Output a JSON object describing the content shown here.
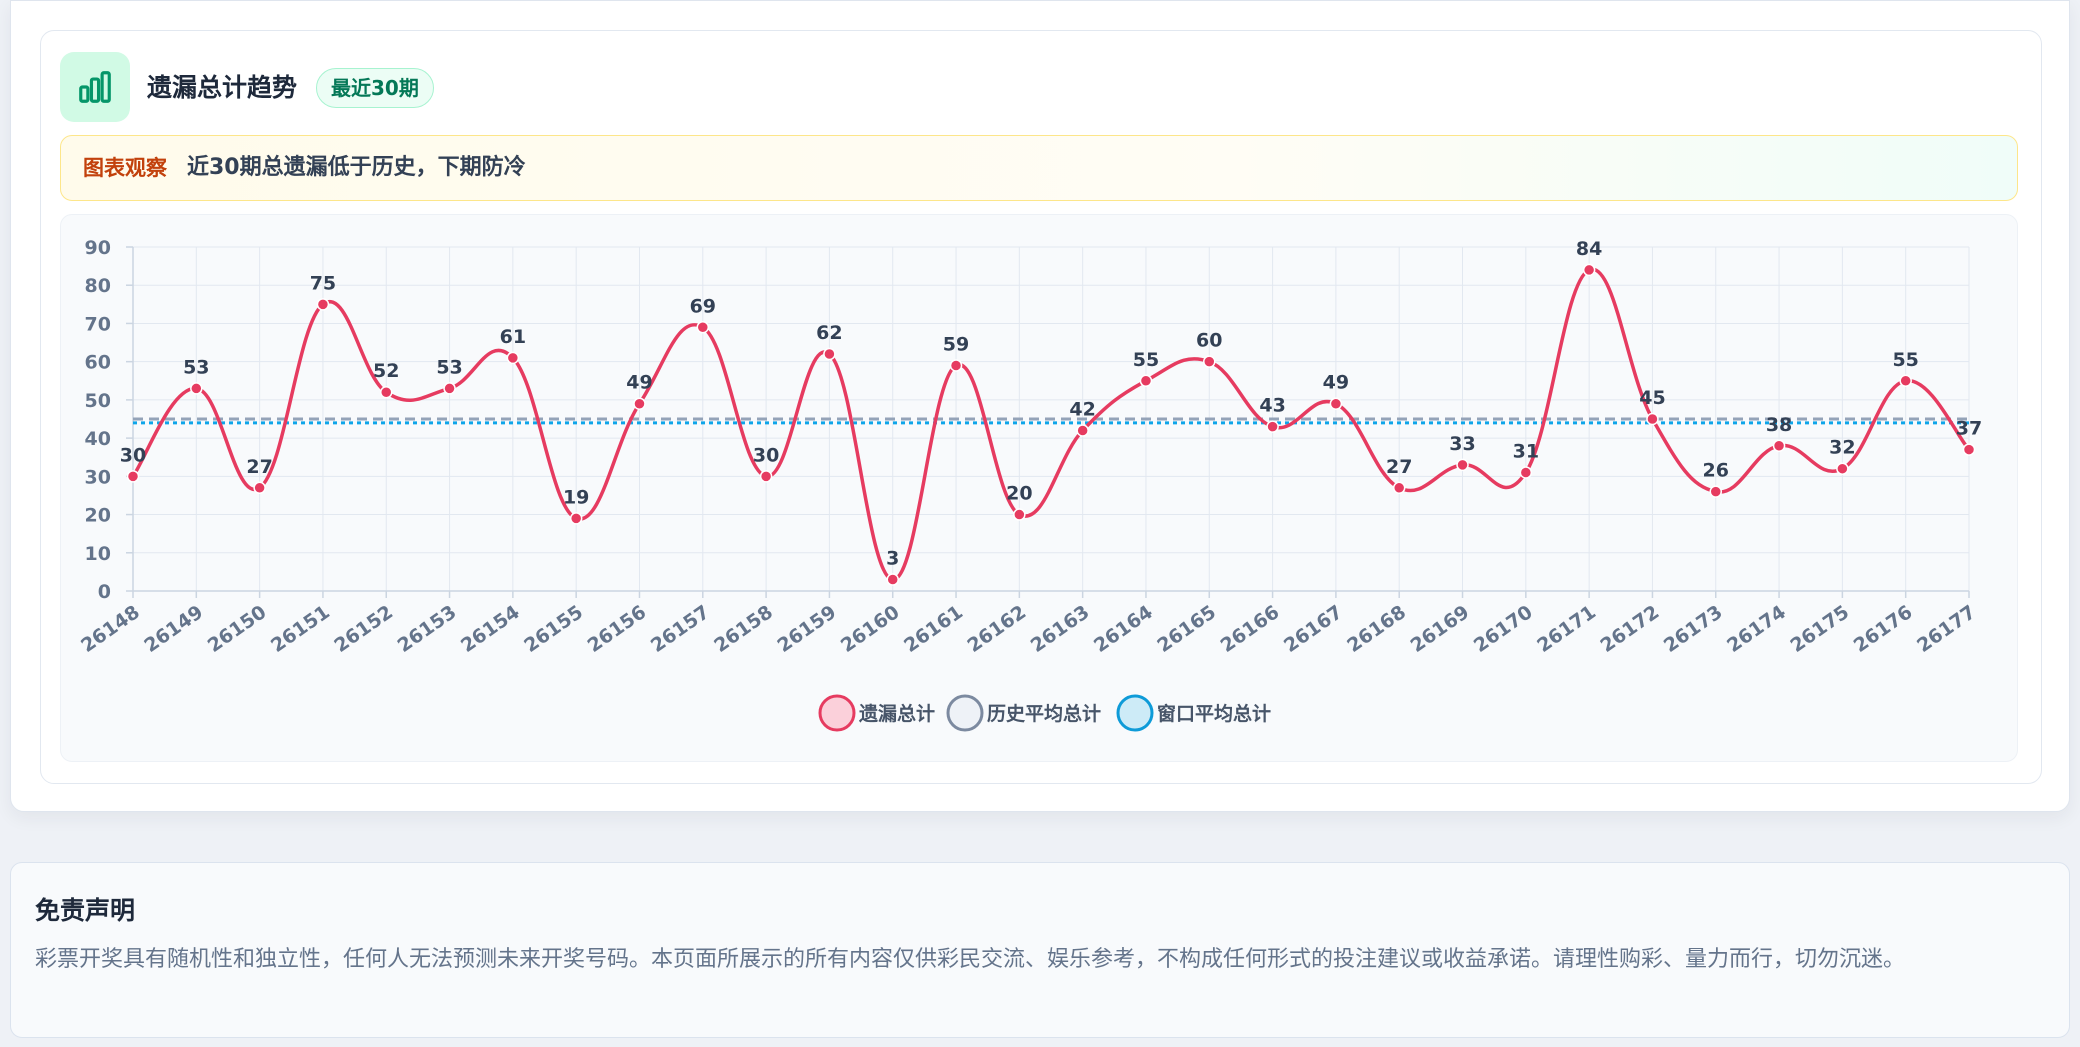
{
  "panel": {
    "title": "遗漏总计趋势",
    "badge": "最近30期",
    "icon": "bar-chart-icon"
  },
  "insight": {
    "label": "图表观察",
    "text": "近30期总遗漏低于历史，下期防冷"
  },
  "disclaimer": {
    "title": "免责声明",
    "text": "彩票开奖具有随机性和独立性，任何人无法预测未来开奖号码。本页面所展示的所有内容仅供彩民交流、娱乐参考，不构成任何形式的投注建议或收益承诺。请理性购彩、量力而行，切勿沉迷。"
  },
  "colors": {
    "series_line": "#e63b60",
    "history_avg": "#94a3b8",
    "window_avg": "#0ea5e9",
    "accent_green": "#059669"
  },
  "chart_data": {
    "type": "line",
    "categories": [
      "26148",
      "26149",
      "26150",
      "26151",
      "26152",
      "26153",
      "26154",
      "26155",
      "26156",
      "26157",
      "26158",
      "26159",
      "26160",
      "26161",
      "26162",
      "26163",
      "26164",
      "26165",
      "26166",
      "26167",
      "26168",
      "26169",
      "26170",
      "26171",
      "26172",
      "26173",
      "26174",
      "26175",
      "26176",
      "26177"
    ],
    "series": [
      {
        "name": "遗漏总计",
        "values": [
          30,
          53,
          27,
          75,
          52,
          53,
          61,
          19,
          49,
          69,
          30,
          62,
          3,
          59,
          20,
          42,
          55,
          60,
          43,
          49,
          27,
          33,
          31,
          84,
          45,
          26,
          38,
          32,
          55,
          37
        ],
        "style": "smooth-line-with-points-and-labels"
      },
      {
        "name": "历史平均总计",
        "values": [
          45,
          45,
          45,
          45,
          45,
          45,
          45,
          45,
          45,
          45,
          45,
          45,
          45,
          45,
          45,
          45,
          45,
          45,
          45,
          45,
          45,
          45,
          45,
          45,
          45,
          45,
          45,
          45,
          45,
          45
        ],
        "style": "dashed"
      },
      {
        "name": "窗口平均总计",
        "values": [
          44,
          44,
          44,
          44,
          44,
          44,
          44,
          44,
          44,
          44,
          44,
          44,
          44,
          44,
          44,
          44,
          44,
          44,
          44,
          44,
          44,
          44,
          44,
          44,
          44,
          44,
          44,
          44,
          44,
          44
        ],
        "style": "dotted"
      }
    ],
    "ylim": [
      0,
      90
    ],
    "yticks": [
      0,
      10,
      20,
      30,
      40,
      50,
      60,
      70,
      80,
      90
    ],
    "grid": true,
    "legend": "bottom-center"
  }
}
